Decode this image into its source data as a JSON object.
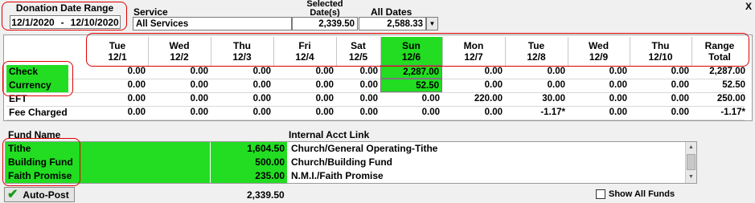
{
  "date_range": {
    "title": "Donation Date Range",
    "from": "12/1/2020",
    "separator": "-",
    "to": "12/10/2020"
  },
  "service": {
    "label": "Service",
    "value": "All Services"
  },
  "selected_dates": {
    "label": "Selected Date(s)",
    "value": "2,339.50"
  },
  "all_dates": {
    "label": "All Dates",
    "value": "2,588.33"
  },
  "close_label": "X",
  "days": [
    {
      "dow": "Tue",
      "date": "12/1"
    },
    {
      "dow": "Wed",
      "date": "12/2"
    },
    {
      "dow": "Thu",
      "date": "12/3"
    },
    {
      "dow": "Fri",
      "date": "12/4"
    },
    {
      "dow": "Sat",
      "date": "12/5"
    },
    {
      "dow": "Sun",
      "date": "12/6"
    },
    {
      "dow": "Mon",
      "date": "12/7"
    },
    {
      "dow": "Tue",
      "date": "12/8"
    },
    {
      "dow": "Wed",
      "date": "12/9"
    },
    {
      "dow": "Thu",
      "date": "12/10"
    },
    {
      "dow": "Range",
      "date": "Total"
    }
  ],
  "selected_day_index": 5,
  "rows": [
    {
      "label": "Check",
      "values": [
        "0.00",
        "0.00",
        "0.00",
        "0.00",
        "0.00",
        "2,287.00",
        "0.00",
        "0.00",
        "0.00",
        "0.00",
        "2,287.00"
      ]
    },
    {
      "label": "Currency",
      "values": [
        "0.00",
        "0.00",
        "0.00",
        "0.00",
        "0.00",
        "52.50",
        "0.00",
        "0.00",
        "0.00",
        "0.00",
        "52.50"
      ]
    },
    {
      "label": "EFT",
      "values": [
        "0.00",
        "0.00",
        "0.00",
        "0.00",
        "0.00",
        "0.00",
        "220.00",
        "30.00",
        "0.00",
        "0.00",
        "250.00"
      ]
    },
    {
      "label": "Fee Charged",
      "values": [
        "0.00",
        "0.00",
        "0.00",
        "0.00",
        "0.00",
        "0.00",
        "0.00",
        "-1.17*",
        "0.00",
        "0.00",
        "-1.17*"
      ]
    }
  ],
  "funds_header": {
    "name": "Fund Name",
    "link": "Internal Acct Link"
  },
  "funds": [
    {
      "name": "Tithe",
      "amount": "1,604.50",
      "link": "Church/General Operating-Tithe"
    },
    {
      "name": "Building Fund",
      "amount": "500.00",
      "link": "Church/Building Fund"
    },
    {
      "name": "Faith Promise",
      "amount": "235.00",
      "link": "N.M.I./Faith Promise"
    }
  ],
  "auto_post_label": "Auto-Post",
  "total": "2,339.50",
  "show_all_funds_label": "Show All Funds",
  "colors": {
    "highlight": "#22dd22",
    "annotation": "#e00000"
  }
}
